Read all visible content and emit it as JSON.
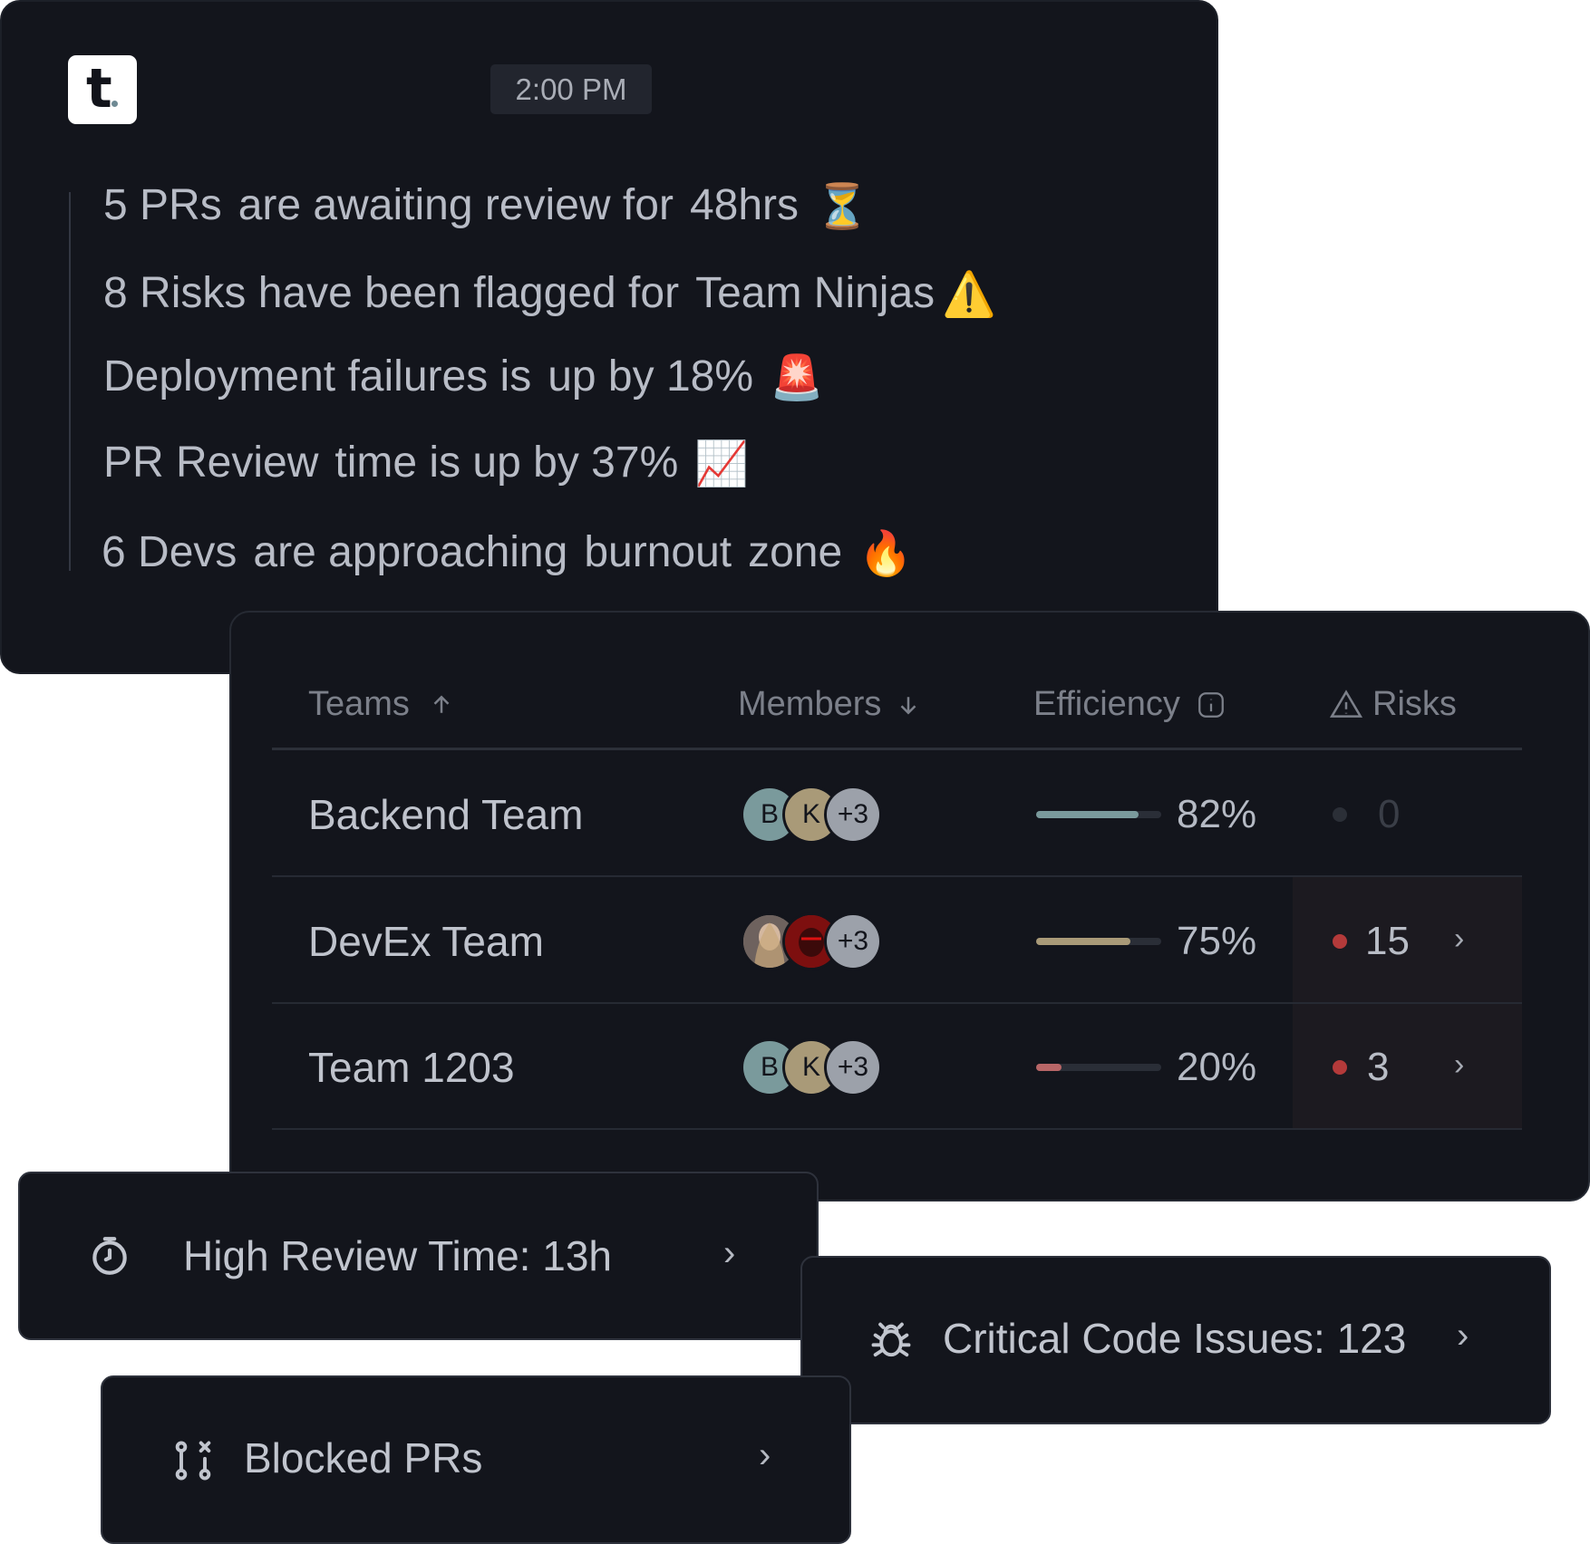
{
  "notifications": {
    "time": "2:00 PM",
    "lines": [
      {
        "parts": [
          "5 PRs",
          "are awaiting review for",
          "48hrs"
        ],
        "emoji": "⏳"
      },
      {
        "parts": [
          "8 Risks have been flagged for",
          "Team Ninjas"
        ],
        "emoji": "⚠️"
      },
      {
        "parts": [
          "Deployment failures is",
          "up by 18%"
        ],
        "emoji": "🚨"
      },
      {
        "parts": [
          "PR Review",
          "time is up by 37%"
        ],
        "emoji": "📈"
      },
      {
        "parts": [
          "6 Devs",
          "are approaching",
          "burnout",
          "zone"
        ],
        "emoji": "🔥"
      }
    ]
  },
  "teams_table": {
    "headers": {
      "teams": "Teams",
      "members": "Members",
      "efficiency": "Efficiency",
      "risks": "Risks"
    },
    "rows": [
      {
        "name": "Backend Team",
        "avatars": [
          "B",
          "K"
        ],
        "more": "+3",
        "efficiency_label": "82%",
        "efficiency": 0.82,
        "bar_color": "#7a9a9c",
        "risks": "0",
        "risk_color": "#2b2f37"
      },
      {
        "name": "DevEx Team",
        "avatars": [
          "",
          ""
        ],
        "more": "+3",
        "efficiency_label": "75%",
        "efficiency": 0.75,
        "bar_color": "#a99a78",
        "risks": "15",
        "risk_color": "#b43a3a"
      },
      {
        "name": "Team 1203",
        "avatars": [
          "B",
          "K"
        ],
        "more": "+3",
        "efficiency_label": "20%",
        "efficiency": 0.2,
        "bar_color": "#b86667",
        "risks": "3",
        "risk_color": "#b43a3a"
      }
    ]
  },
  "alerts": {
    "review": "High Review Time: 13h",
    "critical": "Critical Code Issues: 123",
    "blocked": "Blocked PRs"
  },
  "chevron": "›"
}
